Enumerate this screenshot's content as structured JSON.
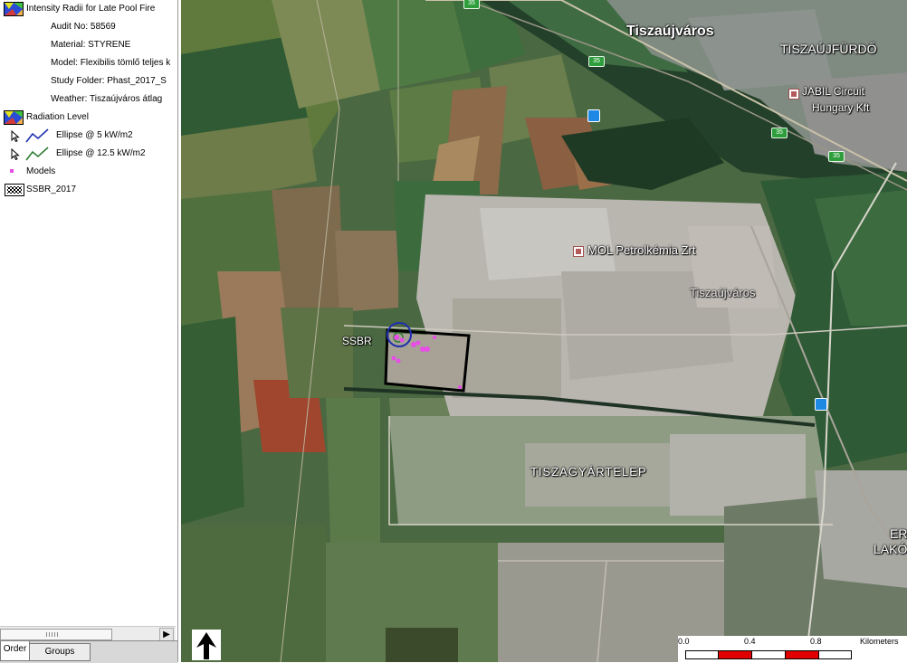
{
  "legend": {
    "title": "Intensity Radii for Late Pool Fire",
    "details": [
      "Audit No: 58569",
      "Material: STYRENE",
      "Model: Flexibilis tömlő teljes k",
      "Study Folder: Phast_2017_S",
      "Weather: Tiszaújváros átlag"
    ],
    "radiation_title": "Radiation Level",
    "ellipses": [
      {
        "label": "Ellipse @ 5 kW/m2",
        "color": "#1f2fb0"
      },
      {
        "label": "Ellipse @ 12.5 kW/m2",
        "color": "#2e7d32"
      }
    ],
    "models_label": "Models",
    "models_color": "#e84de8",
    "ssbr_label": "SSBR_2017"
  },
  "tabs": [
    {
      "label": "Order",
      "active": true
    },
    {
      "label": "Groups",
      "active": false
    }
  ],
  "map": {
    "places": {
      "tiszaujvaros": "Tiszaújváros",
      "tiszaujfurdo": "TISZAÚJFÜRDŐ",
      "jabil_1": "JABIL Circuit",
      "jabil_2": "Hungary Kft",
      "mol": "MOL Petrolkémia Zrt",
      "tiszaujvaros_faint": "Tiszaújváros",
      "tiszagyartelep": "TISZAGYÁRTELEP",
      "ssbr": "SSBR",
      "edge_1": "ER",
      "edge_2": "LAKÓ"
    },
    "road_number": "35",
    "ellipse_color": "#1f2fb0",
    "model_point_color": "#e84de8"
  },
  "scale": {
    "labels": [
      "0.0",
      "0.4",
      "0.8"
    ],
    "unit": "Kilometers",
    "colors": [
      "#ffffff",
      "#e00000"
    ]
  }
}
